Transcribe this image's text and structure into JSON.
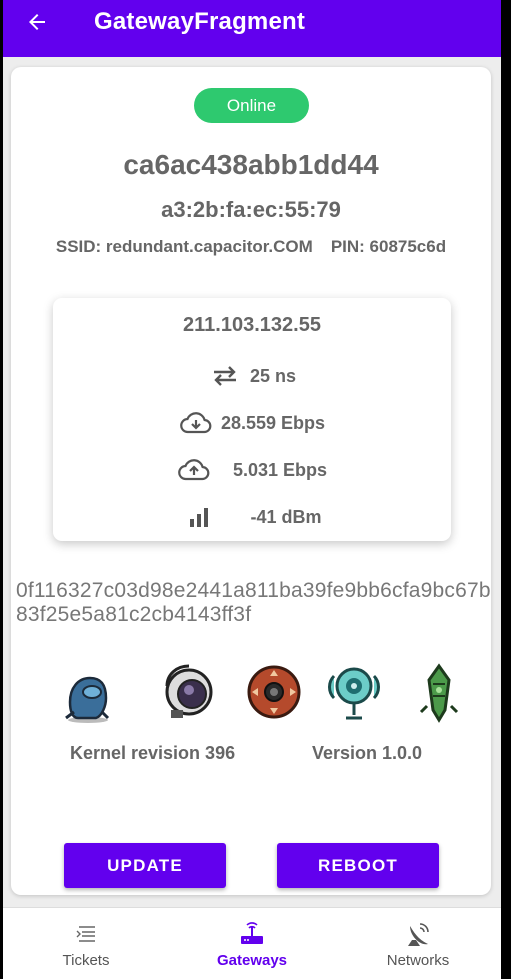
{
  "appbar": {
    "title": "GatewayFragment",
    "back_icon": "arrow-left-icon"
  },
  "gateway": {
    "status": "Online",
    "hostname": "ca6ac438abb1dd44",
    "mac": "a3:2b:fa:ec:55:79",
    "ssid_label": "SSID: redundant.capacitor.COM",
    "pin_label": "PIN: 60875c6d",
    "ip": "211.103.132.55",
    "latency": "25 ns",
    "download": "28.559 Ebps",
    "upload": "5.031 Ebps",
    "signal": "-41 dBm",
    "hash": "0f116327c03d98e2441a811ba39fe9bb6cfa9bc67b83f25e5a81c2cb4143ff3f",
    "kernel": "Kernel revision 396",
    "version": "Version 1.0.0"
  },
  "actions": {
    "update_label": "UPDATE",
    "reboot_label": "REBOOT"
  },
  "navbar": {
    "items": [
      {
        "label": "Tickets",
        "icon": "list-icon"
      },
      {
        "label": "Gateways",
        "icon": "router-icon"
      },
      {
        "label": "Networks",
        "icon": "satellite-dish-icon"
      }
    ],
    "active": "Gateways"
  },
  "colors": {
    "primary": "#6200ee",
    "online": "#2ec96f",
    "text": "#666666"
  }
}
